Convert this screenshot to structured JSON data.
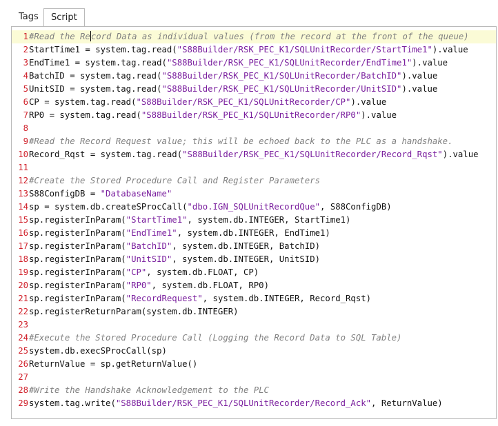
{
  "tabs": [
    {
      "label": "Tags",
      "active": false
    },
    {
      "label": "Script",
      "active": true
    }
  ],
  "colors": {
    "line_number": "#d0202a",
    "comment": "#808080",
    "string": "#7a1f9e",
    "current_line_bg": "#fbfbd6"
  },
  "code_lines": [
    {
      "num": "1",
      "tokens": [
        {
          "t": "comment",
          "v": "#Read the Re"
        },
        {
          "t": "caret"
        },
        {
          "t": "comment",
          "v": "cord Data as individual values (from the record at the front of the queue)"
        }
      ],
      "current": true
    },
    {
      "num": "2",
      "tokens": [
        {
          "t": "plain",
          "v": "StartTime1 = system.tag.read("
        },
        {
          "t": "string",
          "v": "\"S88Builder/RSK_PEC_K1/SQLUnitRecorder/StartTime1\""
        },
        {
          "t": "plain",
          "v": ").value"
        }
      ]
    },
    {
      "num": "3",
      "tokens": [
        {
          "t": "plain",
          "v": "EndTime1 = system.tag.read("
        },
        {
          "t": "string",
          "v": "\"S88Builder/RSK_PEC_K1/SQLUnitRecorder/EndTime1\""
        },
        {
          "t": "plain",
          "v": ").value"
        }
      ]
    },
    {
      "num": "4",
      "tokens": [
        {
          "t": "plain",
          "v": "BatchID = system.tag.read("
        },
        {
          "t": "string",
          "v": "\"S88Builder/RSK_PEC_K1/SQLUnitRecorder/BatchID\""
        },
        {
          "t": "plain",
          "v": ").value"
        }
      ]
    },
    {
      "num": "5",
      "tokens": [
        {
          "t": "plain",
          "v": "UnitSID = system.tag.read("
        },
        {
          "t": "string",
          "v": "\"S88Builder/RSK_PEC_K1/SQLUnitRecorder/UnitSID\""
        },
        {
          "t": "plain",
          "v": ").value"
        }
      ]
    },
    {
      "num": "6",
      "tokens": [
        {
          "t": "plain",
          "v": "CP = system.tag.read("
        },
        {
          "t": "string",
          "v": "\"S88Builder/RSK_PEC_K1/SQLUnitRecorder/CP\""
        },
        {
          "t": "plain",
          "v": ").value"
        }
      ]
    },
    {
      "num": "7",
      "tokens": [
        {
          "t": "plain",
          "v": "RP0 = system.tag.read("
        },
        {
          "t": "string",
          "v": "\"S88Builder/RSK_PEC_K1/SQLUnitRecorder/RP0\""
        },
        {
          "t": "plain",
          "v": ").value"
        }
      ]
    },
    {
      "num": "8",
      "tokens": []
    },
    {
      "num": "9",
      "tokens": [
        {
          "t": "comment",
          "v": "#Read the Record Request value; this will be echoed back to the PLC as a handshake."
        }
      ]
    },
    {
      "num": "10",
      "tokens": [
        {
          "t": "plain",
          "v": "Record_Rqst = system.tag.read("
        },
        {
          "t": "string",
          "v": "\"S88Builder/RSK_PEC_K1/SQLUnitRecorder/Record_Rqst\""
        },
        {
          "t": "plain",
          "v": ").value"
        }
      ]
    },
    {
      "num": "11",
      "tokens": []
    },
    {
      "num": "12",
      "tokens": [
        {
          "t": "comment",
          "v": "#Create the Stored Procedure Call and Register Parameters"
        }
      ]
    },
    {
      "num": "13",
      "tokens": [
        {
          "t": "plain",
          "v": "S88ConfigDB = "
        },
        {
          "t": "string",
          "v": "\"DatabaseName\""
        }
      ]
    },
    {
      "num": "14",
      "tokens": [
        {
          "t": "plain",
          "v": "sp = system.db.createSProcCall("
        },
        {
          "t": "string",
          "v": "\"dbo.IGN_SQLUnitRecordQue\""
        },
        {
          "t": "plain",
          "v": ", S88ConfigDB)"
        }
      ]
    },
    {
      "num": "15",
      "tokens": [
        {
          "t": "plain",
          "v": "sp.registerInParam("
        },
        {
          "t": "string",
          "v": "\"StartTime1\""
        },
        {
          "t": "plain",
          "v": ", system.db.INTEGER, StartTime1)"
        }
      ]
    },
    {
      "num": "16",
      "tokens": [
        {
          "t": "plain",
          "v": "sp.registerInParam("
        },
        {
          "t": "string",
          "v": "\"EndTime1\""
        },
        {
          "t": "plain",
          "v": ", system.db.INTEGER, EndTime1)"
        }
      ]
    },
    {
      "num": "17",
      "tokens": [
        {
          "t": "plain",
          "v": "sp.registerInParam("
        },
        {
          "t": "string",
          "v": "\"BatchID\""
        },
        {
          "t": "plain",
          "v": ", system.db.INTEGER, BatchID)"
        }
      ]
    },
    {
      "num": "18",
      "tokens": [
        {
          "t": "plain",
          "v": "sp.registerInParam("
        },
        {
          "t": "string",
          "v": "\"UnitSID\""
        },
        {
          "t": "plain",
          "v": ", system.db.INTEGER, UnitSID)"
        }
      ]
    },
    {
      "num": "19",
      "tokens": [
        {
          "t": "plain",
          "v": "sp.registerInParam("
        },
        {
          "t": "string",
          "v": "\"CP\""
        },
        {
          "t": "plain",
          "v": ", system.db.FLOAT, CP)"
        }
      ]
    },
    {
      "num": "20",
      "tokens": [
        {
          "t": "plain",
          "v": "sp.registerInParam("
        },
        {
          "t": "string",
          "v": "\"RP0\""
        },
        {
          "t": "plain",
          "v": ", system.db.FLOAT, RP0)"
        }
      ]
    },
    {
      "num": "21",
      "tokens": [
        {
          "t": "plain",
          "v": "sp.registerInParam("
        },
        {
          "t": "string",
          "v": "\"RecordRequest\""
        },
        {
          "t": "plain",
          "v": ", system.db.INTEGER, Record_Rqst)"
        }
      ]
    },
    {
      "num": "22",
      "tokens": [
        {
          "t": "plain",
          "v": "sp.registerReturnParam(system.db.INTEGER)"
        }
      ]
    },
    {
      "num": "23",
      "tokens": []
    },
    {
      "num": "24",
      "tokens": [
        {
          "t": "comment",
          "v": "#Execute the Stored Procedure Call (Logging the Record Data to SQL Table)"
        }
      ]
    },
    {
      "num": "25",
      "tokens": [
        {
          "t": "plain",
          "v": "system.db.execSProcCall(sp)"
        }
      ]
    },
    {
      "num": "26",
      "tokens": [
        {
          "t": "plain",
          "v": "ReturnValue = sp.getReturnValue()"
        }
      ]
    },
    {
      "num": "27",
      "tokens": []
    },
    {
      "num": "28",
      "tokens": [
        {
          "t": "comment",
          "v": "#Write the Handshake Acknowledgement to the PLC"
        }
      ]
    },
    {
      "num": "29",
      "tokens": [
        {
          "t": "plain",
          "v": "system.tag.write("
        },
        {
          "t": "string",
          "v": "\"S88Builder/RSK_PEC_K1/SQLUnitRecorder/Record_Ack\""
        },
        {
          "t": "plain",
          "v": ", ReturnValue)"
        }
      ]
    }
  ]
}
